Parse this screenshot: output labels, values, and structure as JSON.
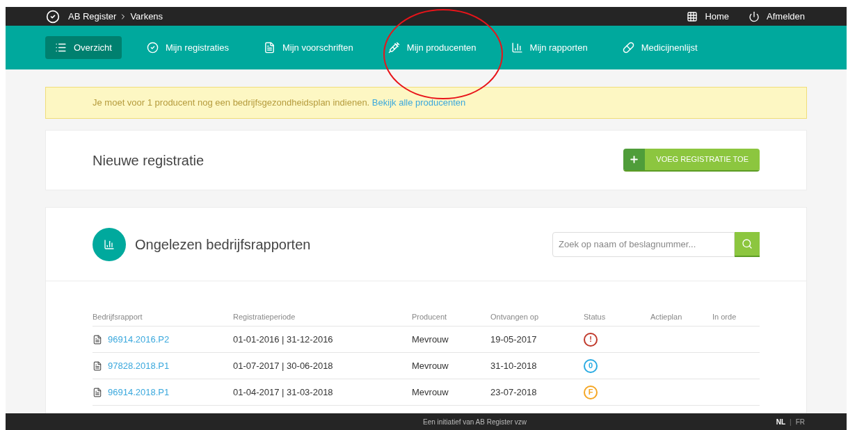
{
  "breadcrumb": [
    "AB Register",
    "Varkens"
  ],
  "top_links": [
    {
      "kind": "home",
      "label": "Home"
    },
    {
      "kind": "logout",
      "label": "Afmelden"
    }
  ],
  "nav": [
    {
      "kind": "list",
      "label": "Overzicht",
      "selected": true
    },
    {
      "kind": "check",
      "label": "Mijn registraties",
      "selected": false
    },
    {
      "kind": "doc",
      "label": "Mijn voorschriften",
      "selected": false
    },
    {
      "kind": "syringe",
      "label": "Mijn producenten",
      "selected": false
    },
    {
      "kind": "bars",
      "label": "Mijn rapporten",
      "selected": false
    },
    {
      "kind": "pill",
      "label": "Medicijnenlijst",
      "selected": false
    }
  ],
  "alert": {
    "text": "Je moet voor 1 producent nog een bedrijfsgezondheidsplan indienen.",
    "link": "Bekijk alle producenten"
  },
  "new_registration": {
    "title": "Nieuwe registratie",
    "button": "VOEG REGISTRATIE TOE"
  },
  "reports": {
    "title": "Ongelezen bedrijfsrapporten",
    "search": {
      "placeholder": "Zoek op naam of beslagnummer..."
    },
    "table": {
      "columns": [
        "Bedrijfsrapport",
        "Registratieperiode",
        "Producent",
        "Ontvangen op",
        "Status",
        "Actieplan",
        "In orde"
      ],
      "rows": [
        {
          "report": "96914.2016.P2",
          "period": "01-01-2016 | 31-12-2016",
          "producer": "Mevrouw",
          "received": "19-05-2017",
          "status": {
            "symbol": "!",
            "color": "#c0392b"
          }
        },
        {
          "report": "97828.2018.P1",
          "period": "01-07-2017 | 30-06-2018",
          "producer": "Mevrouw",
          "received": "31-10-2018",
          "status": {
            "symbol": "0",
            "color": "#29abe2"
          }
        },
        {
          "report": "96914.2018.P1",
          "period": "01-04-2017 | 31-03-2018",
          "producer": "Mevrouw",
          "received": "23-07-2018",
          "status": {
            "symbol": "F",
            "color": "#f5a623"
          }
        }
      ]
    }
  },
  "footer": {
    "text": "Een initiatief van AB Register vzw",
    "separator": "|",
    "languages": [
      {
        "label": "NL",
        "selected": true
      },
      {
        "label": "FR",
        "selected": false
      }
    ]
  }
}
